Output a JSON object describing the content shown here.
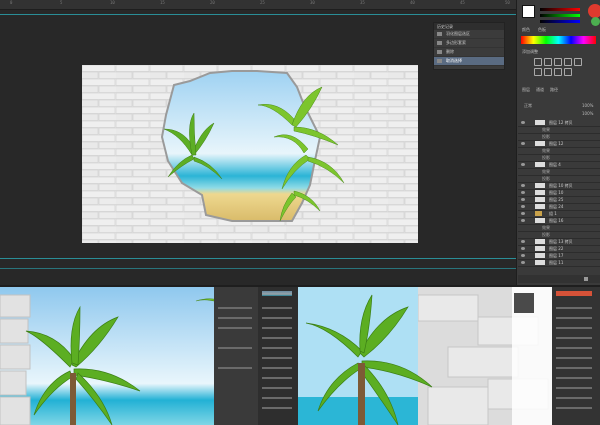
{
  "ruler": {
    "ticks": [
      "0",
      "5",
      "10",
      "15",
      "20",
      "25",
      "30",
      "35",
      "40",
      "45",
      "50"
    ]
  },
  "history_panel": {
    "title": "历史记录",
    "items": [
      {
        "label": "羽化图层选区",
        "selected": false
      },
      {
        "label": "多边形套索",
        "selected": false
      },
      {
        "label": "删除",
        "selected": false
      },
      {
        "label": "取消选择",
        "selected": true
      }
    ]
  },
  "right_panel": {
    "tabs": [
      "颜色",
      "色板"
    ],
    "adjust_title": "添加调整",
    "layers_tabs": [
      "图层",
      "通道",
      "路径"
    ],
    "blend_mode": "正常",
    "opacity": "100%",
    "fill": "100%",
    "layers": [
      {
        "name": "图层 12 拷贝",
        "type": "layer"
      },
      {
        "name": "效果",
        "type": "sub"
      },
      {
        "name": "投影",
        "type": "sub"
      },
      {
        "name": "图层 12",
        "type": "layer"
      },
      {
        "name": "效果",
        "type": "sub"
      },
      {
        "name": "投影",
        "type": "sub"
      },
      {
        "name": "图层 4",
        "type": "layer"
      },
      {
        "name": "效果",
        "type": "sub"
      },
      {
        "name": "投影",
        "type": "sub"
      },
      {
        "name": "图层 10 拷贝",
        "type": "layer"
      },
      {
        "name": "图层 10",
        "type": "layer"
      },
      {
        "name": "图层 25",
        "type": "layer"
      },
      {
        "name": "图层 24",
        "type": "layer"
      },
      {
        "name": "组 1",
        "type": "group"
      },
      {
        "name": "图层 16",
        "type": "layer"
      },
      {
        "name": "效果",
        "type": "sub"
      },
      {
        "name": "投影",
        "type": "sub"
      },
      {
        "name": "图层 13 拷贝",
        "type": "layer"
      },
      {
        "name": "图层 22",
        "type": "layer"
      },
      {
        "name": "图层 17",
        "type": "layer"
      },
      {
        "name": "图层 11",
        "type": "layer"
      }
    ]
  },
  "colors": {
    "accent_guide": "#2aa7b3",
    "selection": "#5a6b82",
    "sky": "#bfe3f7",
    "sea": "#29b5d8",
    "sand": "#e9d48d",
    "palm": "#6fbf2a",
    "wall": "#e3e3e3"
  },
  "icons": [
    "eye-icon",
    "history-snapshot-icon",
    "trash-icon",
    "adjustment-icon",
    "folder-icon"
  ]
}
